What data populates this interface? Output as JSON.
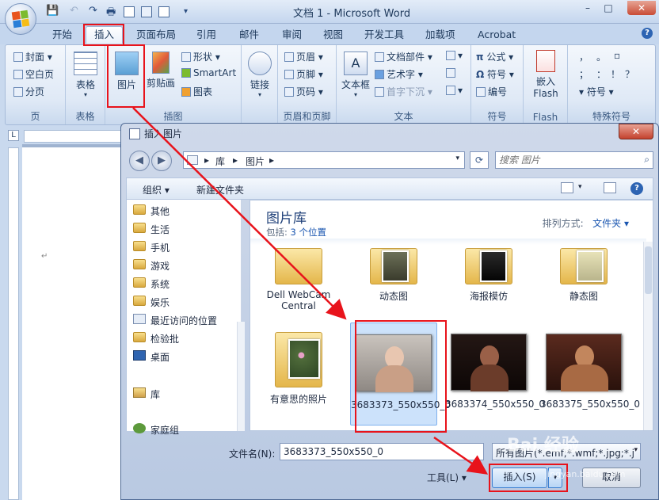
{
  "window": {
    "title": "文档 1 - Microsoft Word",
    "minimize": "–",
    "maximize": "□",
    "close": "✕"
  },
  "qat": [
    "💾",
    "↶",
    "↷",
    "🖶"
  ],
  "tabs": [
    "开始",
    "插入",
    "页面布局",
    "引用",
    "邮件",
    "审阅",
    "视图",
    "开发工具",
    "加载项",
    "Acrobat"
  ],
  "active_tab": "插入",
  "ribbon": {
    "page_group": {
      "label": "页",
      "items": [
        "封面",
        "空白页",
        "分页"
      ]
    },
    "table_group": {
      "label": "表格",
      "button": "表格"
    },
    "illustrations_group": {
      "label": "插图",
      "picture": "图片",
      "clipart": "剪贴画",
      "shapes": "形状",
      "smartart": "SmartArt",
      "chart": "图表"
    },
    "links_group": {
      "button": "链接"
    },
    "header_footer_group": {
      "label": "页眉和页脚",
      "items": [
        "页眉",
        "页脚",
        "页码"
      ]
    },
    "text_group": {
      "label": "文本",
      "textbox": "文本框",
      "items": [
        "文档部件",
        "艺术字",
        "首字下沉"
      ]
    },
    "symbols_group": {
      "label": "符号",
      "items": [
        "公式",
        "符号",
        "编号"
      ]
    },
    "flash_group": {
      "label": "Flash",
      "button": "嵌入 Flash"
    },
    "special_group": {
      "label": "特殊符号",
      "items": [
        "，",
        "。",
        "；",
        "：",
        "！",
        "？",
        "符号"
      ]
    }
  },
  "dialog": {
    "title": "插入图片",
    "close": "✕",
    "breadcrumb": [
      "库",
      "图片"
    ],
    "search_placeholder": "搜索 图片",
    "organize": "组织 ▾",
    "new_folder": "新建文件夹",
    "nav_items": [
      "其他",
      "生活",
      "手机",
      "游戏",
      "系统",
      "娱乐",
      "最近访问的位置",
      "检验批",
      "桌面"
    ],
    "library_nav": "库",
    "homegroup": "家庭组",
    "library_title": "图片库",
    "includes_label": "包括:",
    "includes_link": "3 个位置",
    "sort_label": "排列方式:",
    "sort_value": "文件夹 ▾",
    "tiles": [
      {
        "name": "Dell WebCam Central",
        "kind": "folder"
      },
      {
        "name": "动态图",
        "kind": "folder"
      },
      {
        "name": "海报模仿",
        "kind": "folder"
      },
      {
        "name": "静态图",
        "kind": "folder"
      },
      {
        "name": "有意思的照片",
        "kind": "folder"
      },
      {
        "name": "3683373_550x550_0",
        "kind": "image",
        "selected": true
      },
      {
        "name": "3683374_550x550_0",
        "kind": "image"
      },
      {
        "name": "3683375_550x550_0",
        "kind": "image"
      }
    ],
    "filename_label": "文件名(N):",
    "filename_value": "3683373_550x550_0",
    "filetype_value": "所有图片(*.emf;*.wmf;*.jpg;*.j",
    "tools": "工具(L) ▾",
    "insert": "插入(S)",
    "insert_dd": "▾",
    "cancel": "取消"
  },
  "watermark": {
    "text": "Bai 经验",
    "url": "jingyan.baidu.com"
  },
  "colors": {
    "highlight": "#e8131b",
    "arrow": "#e8131b"
  }
}
